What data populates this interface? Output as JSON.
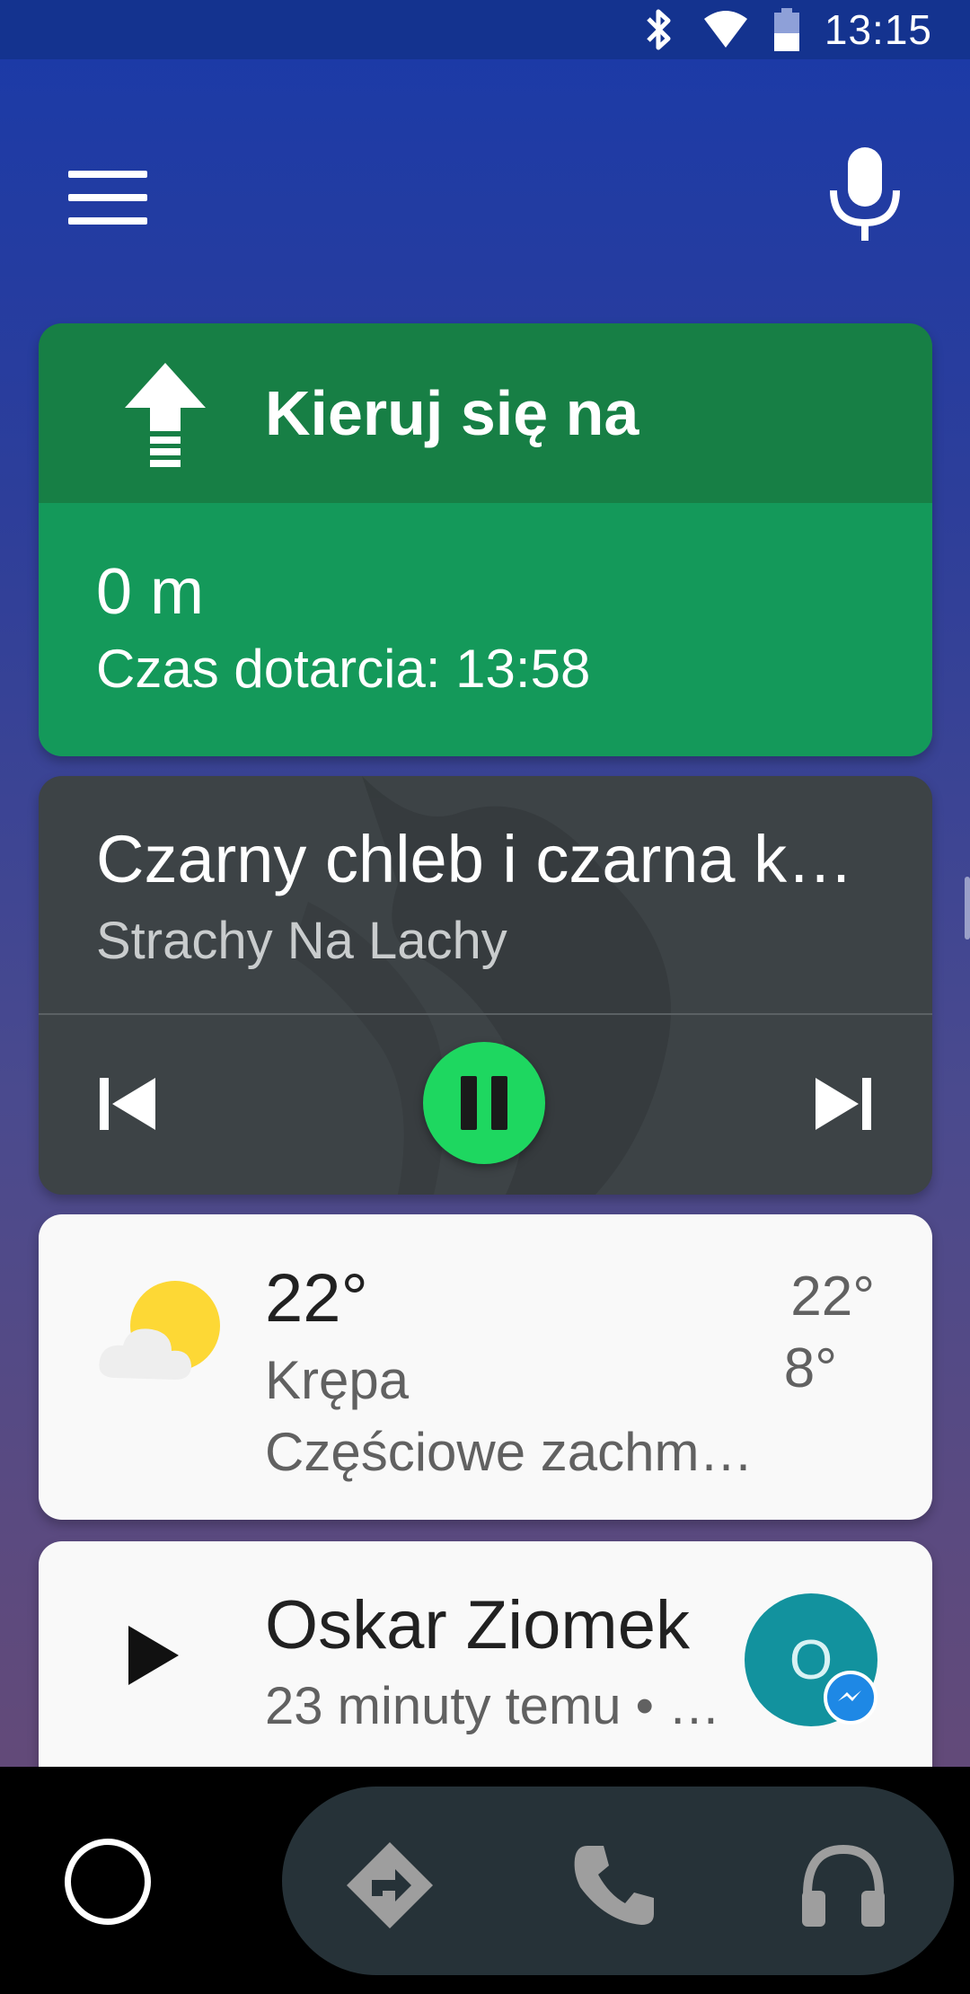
{
  "status_bar": {
    "time": "13:15",
    "icons": [
      "bluetooth-icon",
      "wifi-icon",
      "battery-icon"
    ]
  },
  "top_bar": {
    "menu_icon": "menu-icon",
    "mic_icon": "microphone-icon"
  },
  "navigation_card": {
    "direction_icon": "arrow-straight-icon",
    "instruction": "Kieruj się na",
    "distance": "0 m",
    "eta": "Czas dotarcia: 13:58",
    "colors": {
      "header": "#177f45",
      "body": "#14995a"
    }
  },
  "media_card": {
    "title": "Czarny chleb i czarna ka…",
    "artist": "Strachy Na Lachy",
    "controls": [
      "previous-icon",
      "pause-icon",
      "next-icon"
    ],
    "accent_color": "#1ed760"
  },
  "weather_card": {
    "icon": "partly-cloudy-icon",
    "temperature": "22°",
    "city": "Krępa",
    "description": "Częściowe zachmu…",
    "high": "22°",
    "low": "8°"
  },
  "message_card": {
    "play_icon": "play-icon",
    "sender": "Oskar Ziomek",
    "time_info": "23 minuty temu • …",
    "avatar_letter": "O",
    "avatar_color": "#12929e",
    "badge_icon": "messenger-icon"
  },
  "bottom_nav": {
    "items": [
      "home-icon",
      "navigation-icon",
      "phone-icon",
      "headphones-icon"
    ]
  }
}
